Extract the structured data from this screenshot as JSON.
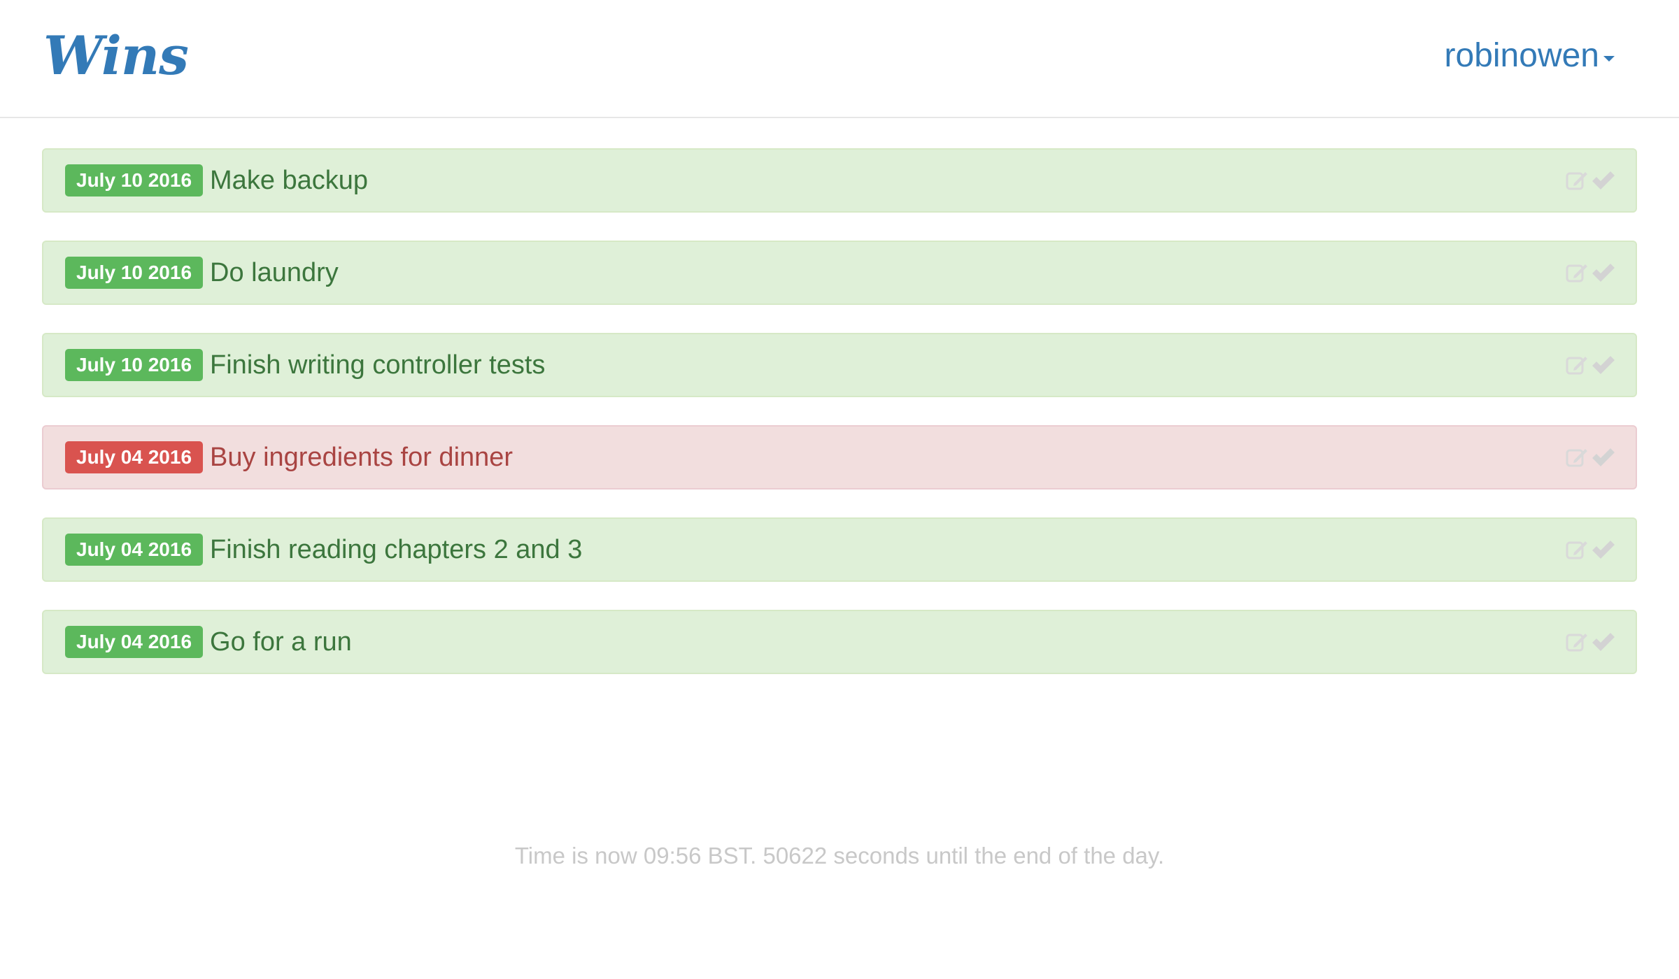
{
  "navbar": {
    "brand": "Wins",
    "user": "robinowen"
  },
  "items": [
    {
      "date": "July 10 2016",
      "title": "Make backup",
      "status": "success"
    },
    {
      "date": "July 10 2016",
      "title": "Do laundry",
      "status": "success"
    },
    {
      "date": "July 10 2016",
      "title": "Finish writing controller tests",
      "status": "success"
    },
    {
      "date": "July 04 2016",
      "title": "Buy ingredients for dinner",
      "status": "failure"
    },
    {
      "date": "July 04 2016",
      "title": "Finish reading chapters 2 and 3",
      "status": "success"
    },
    {
      "date": "July 04 2016",
      "title": "Go for a run",
      "status": "success"
    }
  ],
  "icons": {
    "edit": "edit-icon",
    "complete": "checkmark-icon"
  },
  "colors": {
    "brand": "#337ab7",
    "success_bg": "#dff0d8",
    "success_label": "#5cb85c",
    "success_text": "#3c763d",
    "failure_bg": "#f2dede",
    "failure_label": "#d9534f",
    "failure_text": "#a94442"
  },
  "footer": {
    "text": "Time is now 09:56 BST. 50622 seconds until the end of the day."
  }
}
